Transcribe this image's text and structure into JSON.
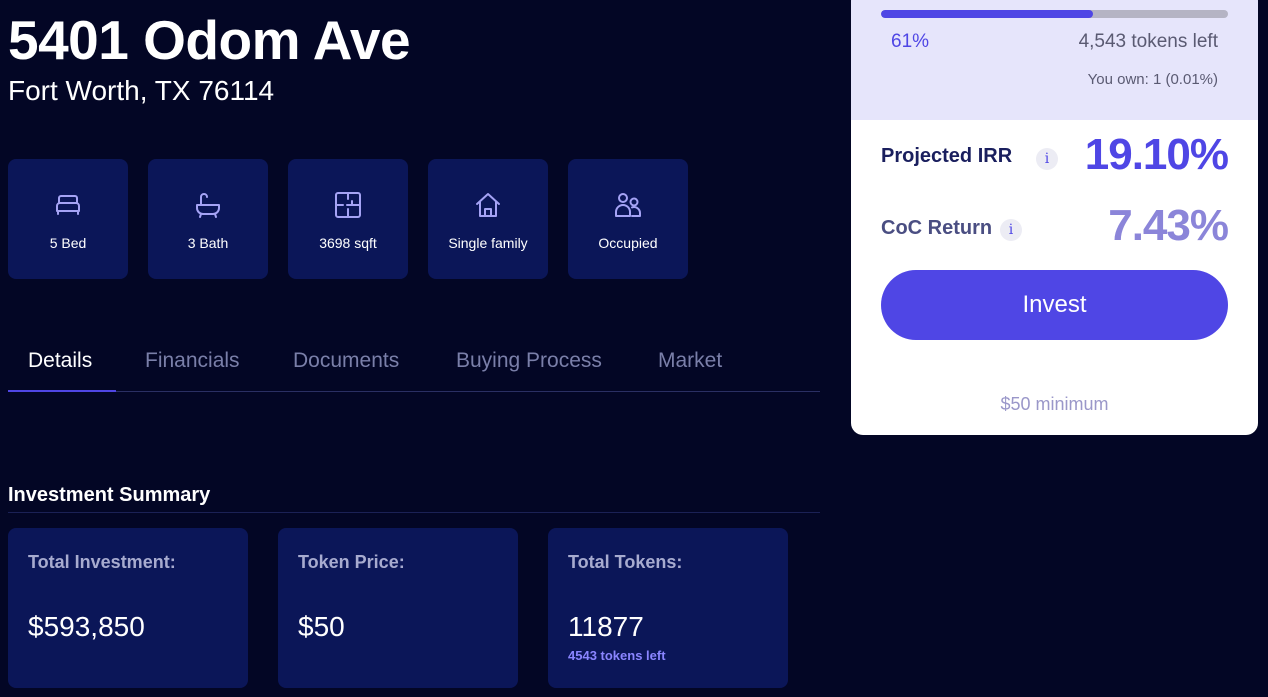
{
  "property": {
    "address": "5401 Odom Ave",
    "city_line": "Fort Worth, TX 76114"
  },
  "features": [
    {
      "icon": "bed-icon",
      "label": "5 Bed"
    },
    {
      "icon": "bathtub-icon",
      "label": "3 Bath"
    },
    {
      "icon": "floorplan-icon",
      "label": "3698 sqft"
    },
    {
      "icon": "house-icon",
      "label": "Single family"
    },
    {
      "icon": "people-icon",
      "label": "Occupied"
    }
  ],
  "tabs": [
    {
      "label": "Details",
      "active": true
    },
    {
      "label": "Financials",
      "active": false
    },
    {
      "label": "Documents",
      "active": false
    },
    {
      "label": "Buying Process",
      "active": false
    },
    {
      "label": "Market",
      "active": false
    }
  ],
  "summary": {
    "title": "Investment Summary",
    "cards": [
      {
        "label": "Total Investment:",
        "value": "$593,850",
        "sub": ""
      },
      {
        "label": "Token Price:",
        "value": "$50",
        "sub": ""
      },
      {
        "label": "Total Tokens:",
        "value": "11877",
        "sub": "4543 tokens left"
      }
    ]
  },
  "panel": {
    "progress_fraction": 0.61,
    "progress_label": "61%",
    "tokens_left": "4,543 tokens left",
    "you_own": "You own: 1 (0.01%)",
    "irr_label": "Projected IRR",
    "irr_value": "19.10%",
    "coc_label": "CoC Return",
    "coc_value": "7.43%",
    "info_glyph": "i",
    "invest_label": "Invest",
    "minimum": "$50 minimum"
  },
  "colors": {
    "background": "#030625",
    "tile": "#0b1658",
    "accent": "#4f46e5",
    "icon": "#a5a3f5"
  }
}
